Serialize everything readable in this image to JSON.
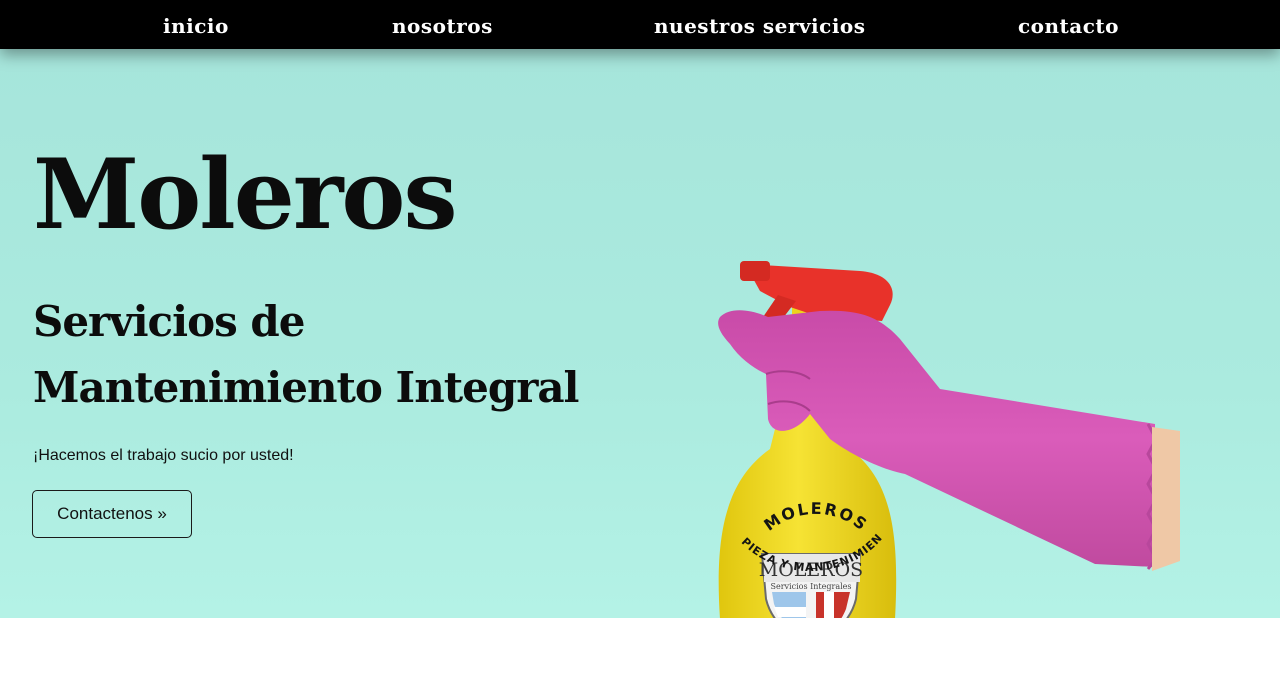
{
  "nav": {
    "items": [
      {
        "label": "inicio"
      },
      {
        "label": "nosotros"
      },
      {
        "label": "nuestros servicios"
      },
      {
        "label": "contacto"
      }
    ]
  },
  "hero": {
    "title": "Moleros",
    "subtitle": "Servicios de Mantenimiento Integral",
    "tagline": "¡Hacemos el trabajo sucio por usted!",
    "button_label": "Contactenos »"
  },
  "bottle_label": {
    "brand_arc": "MOLEROS",
    "shield_title": "MOLEROS",
    "shield_subtitle": "Servicios Integrales",
    "bottom_arc": "LIMPIEZA Y MANTENIMIENTO"
  },
  "colors": {
    "nav_bg": "#000000",
    "hero_bg": "#abebdf",
    "bottle": "#f2dc1c",
    "trigger": "#e8322a",
    "glove": "#d656b4",
    "skin": "#f0c9a8"
  }
}
